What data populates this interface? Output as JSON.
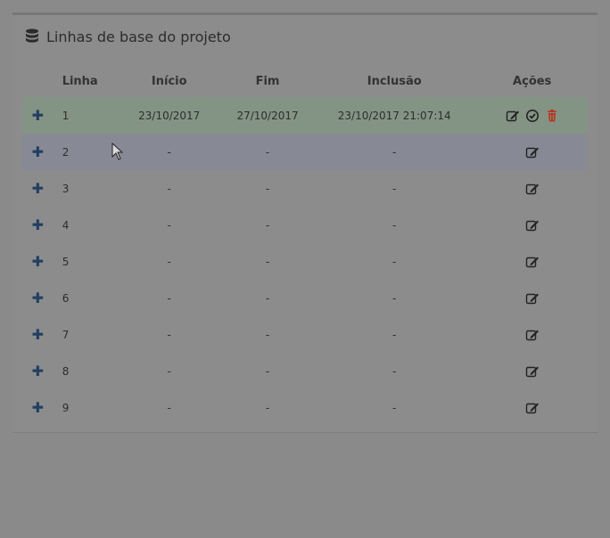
{
  "panel": {
    "title": "Linhas de base do projeto",
    "icon": "database-icon"
  },
  "table": {
    "headers": {
      "linha": "Linha",
      "inicio": "Início",
      "fim": "Fim",
      "inclusao": "Inclusão",
      "acoes": "Ações"
    },
    "rows": [
      {
        "linha": "1",
        "inicio": "23/10/2017",
        "fim": "27/10/2017",
        "inclusao": "23/10/2017 21:07:14"
      },
      {
        "linha": "2",
        "inicio": "-",
        "fim": "-",
        "inclusao": "-"
      },
      {
        "linha": "3",
        "inicio": "-",
        "fim": "-",
        "inclusao": "-"
      },
      {
        "linha": "4",
        "inicio": "-",
        "fim": "-",
        "inclusao": "-"
      },
      {
        "linha": "5",
        "inicio": "-",
        "fim": "-",
        "inclusao": "-"
      },
      {
        "linha": "6",
        "inicio": "-",
        "fim": "-",
        "inclusao": "-"
      },
      {
        "linha": "7",
        "inicio": "-",
        "fim": "-",
        "inclusao": "-"
      },
      {
        "linha": "8",
        "inicio": "-",
        "fim": "-",
        "inclusao": "-"
      },
      {
        "linha": "9",
        "inicio": "-",
        "fim": "-",
        "inclusao": "-"
      }
    ],
    "expand_symbol": "✚"
  },
  "colors": {
    "accent": "#223f63",
    "delete": "#b5391e",
    "active_row": "#849484",
    "hover_row": "#878a95"
  }
}
